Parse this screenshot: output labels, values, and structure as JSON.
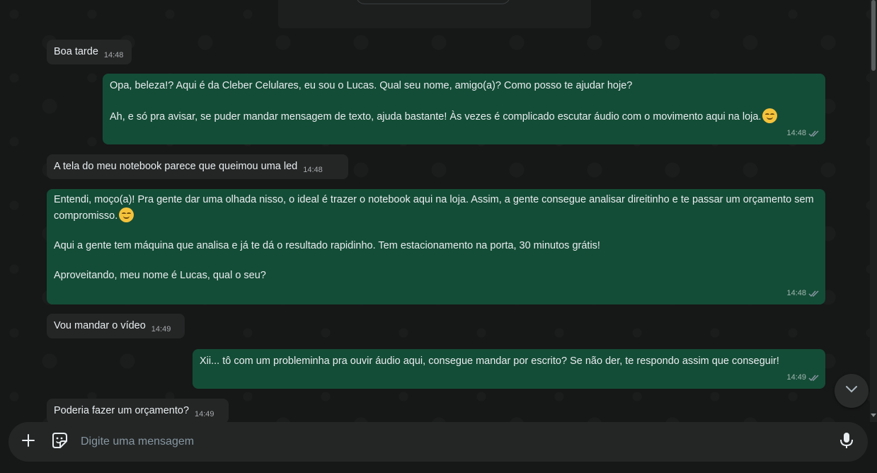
{
  "messages": [
    {
      "dir": "in",
      "text": "Boa tarde",
      "time": "14:48"
    },
    {
      "dir": "out",
      "text": "Opa, beleza!? Aqui é da Cleber Celulares, eu sou o Lucas. Qual seu nome, amigo(a)? Como posso te ajudar hoje?\n\nAh, e só pra avisar, se puder mandar mensagem de texto, ajuda bastante! Às vezes é complicado escutar áudio com o movimento aqui na loja.",
      "time": "14:48"
    },
    {
      "dir": "in",
      "text": "A tela do meu notebook parece que queimou uma led",
      "time": "14:48"
    },
    {
      "dir": "out",
      "text_a": "Entendi, moço(a)! Pra gente dar uma olhada nisso, o ideal é trazer o notebook aqui na loja. Assim, a gente consegue analisar direitinho e te passar um orçamento sem compromisso.",
      "text_b": "Aqui a gente tem máquina que analisa e já te dá o resultado rapidinho. Tem estacionamento na porta, 30 minutos grátis!\n\nAproveitando, meu nome é Lucas, qual o seu?",
      "time": "14:48"
    },
    {
      "dir": "in",
      "text": "Vou mandar o vídeo",
      "time": "14:49"
    },
    {
      "dir": "out",
      "text": "Xii... tô com um probleminha pra ouvir áudio aqui, consegue mandar por escrito? Se não der, te respondo assim que conseguir!",
      "time": "14:49"
    },
    {
      "dir": "in",
      "text": "Poderia fazer um orçamento?",
      "time": "14:49"
    }
  ],
  "composer": {
    "placeholder": "Digite uma mensagem"
  },
  "icons": {
    "attach": "plus-icon",
    "sticker": "sticker-icon",
    "mic": "microphone-icon",
    "scroll": "chevron-down-icon",
    "read": "double-check-icon"
  },
  "colors": {
    "background": "#161717",
    "incoming": "#242626",
    "outgoing": "#144d37",
    "composer": "#242626"
  }
}
